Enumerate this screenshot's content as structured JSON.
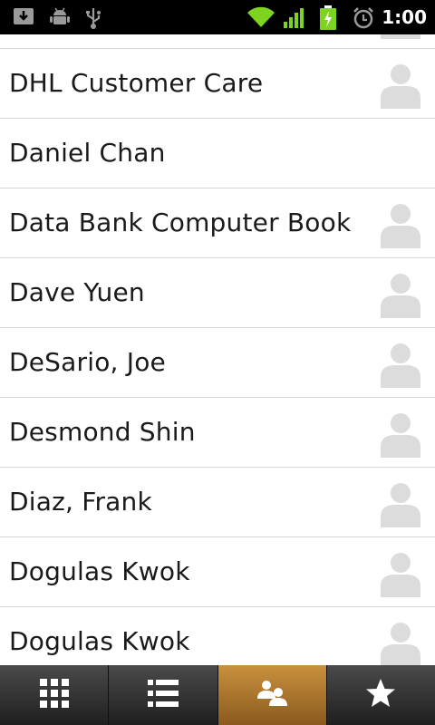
{
  "status_bar": {
    "time": "1:00",
    "icons": [
      "download-icon",
      "android-debug-icon",
      "usb-icon",
      "wifi-icon",
      "signal-icon",
      "battery-charging-icon",
      "alarm-icon"
    ]
  },
  "contacts": [
    {
      "name": "",
      "has_photo_placeholder": true
    },
    {
      "name": "DHL Customer Care",
      "has_photo_placeholder": true
    },
    {
      "name": "Daniel Chan",
      "has_photo_placeholder": false
    },
    {
      "name": "Data Bank Computer Book",
      "has_photo_placeholder": true
    },
    {
      "name": "Dave Yuen",
      "has_photo_placeholder": true
    },
    {
      "name": "DeSario, Joe",
      "has_photo_placeholder": true
    },
    {
      "name": "Desmond Shin",
      "has_photo_placeholder": true
    },
    {
      "name": "Diaz, Frank",
      "has_photo_placeholder": true
    },
    {
      "name": "Dogulas Kwok",
      "has_photo_placeholder": true
    },
    {
      "name": "Dogulas Kwok",
      "has_photo_placeholder": true
    }
  ],
  "tabs": [
    {
      "icon": "dialpad-icon",
      "active": false
    },
    {
      "icon": "call-log-icon",
      "active": false
    },
    {
      "icon": "contacts-icon",
      "active": true
    },
    {
      "icon": "favorites-star-icon",
      "active": false
    }
  ],
  "colors": {
    "status_bar_bg": "#000000",
    "list_bg": "#ffffff",
    "divider": "#d6d6d6",
    "text": "#1a1a1a",
    "tab_active": "#b07a2e",
    "tab_bar": "#2e2e2e",
    "wifi_green": "#7ed321"
  }
}
